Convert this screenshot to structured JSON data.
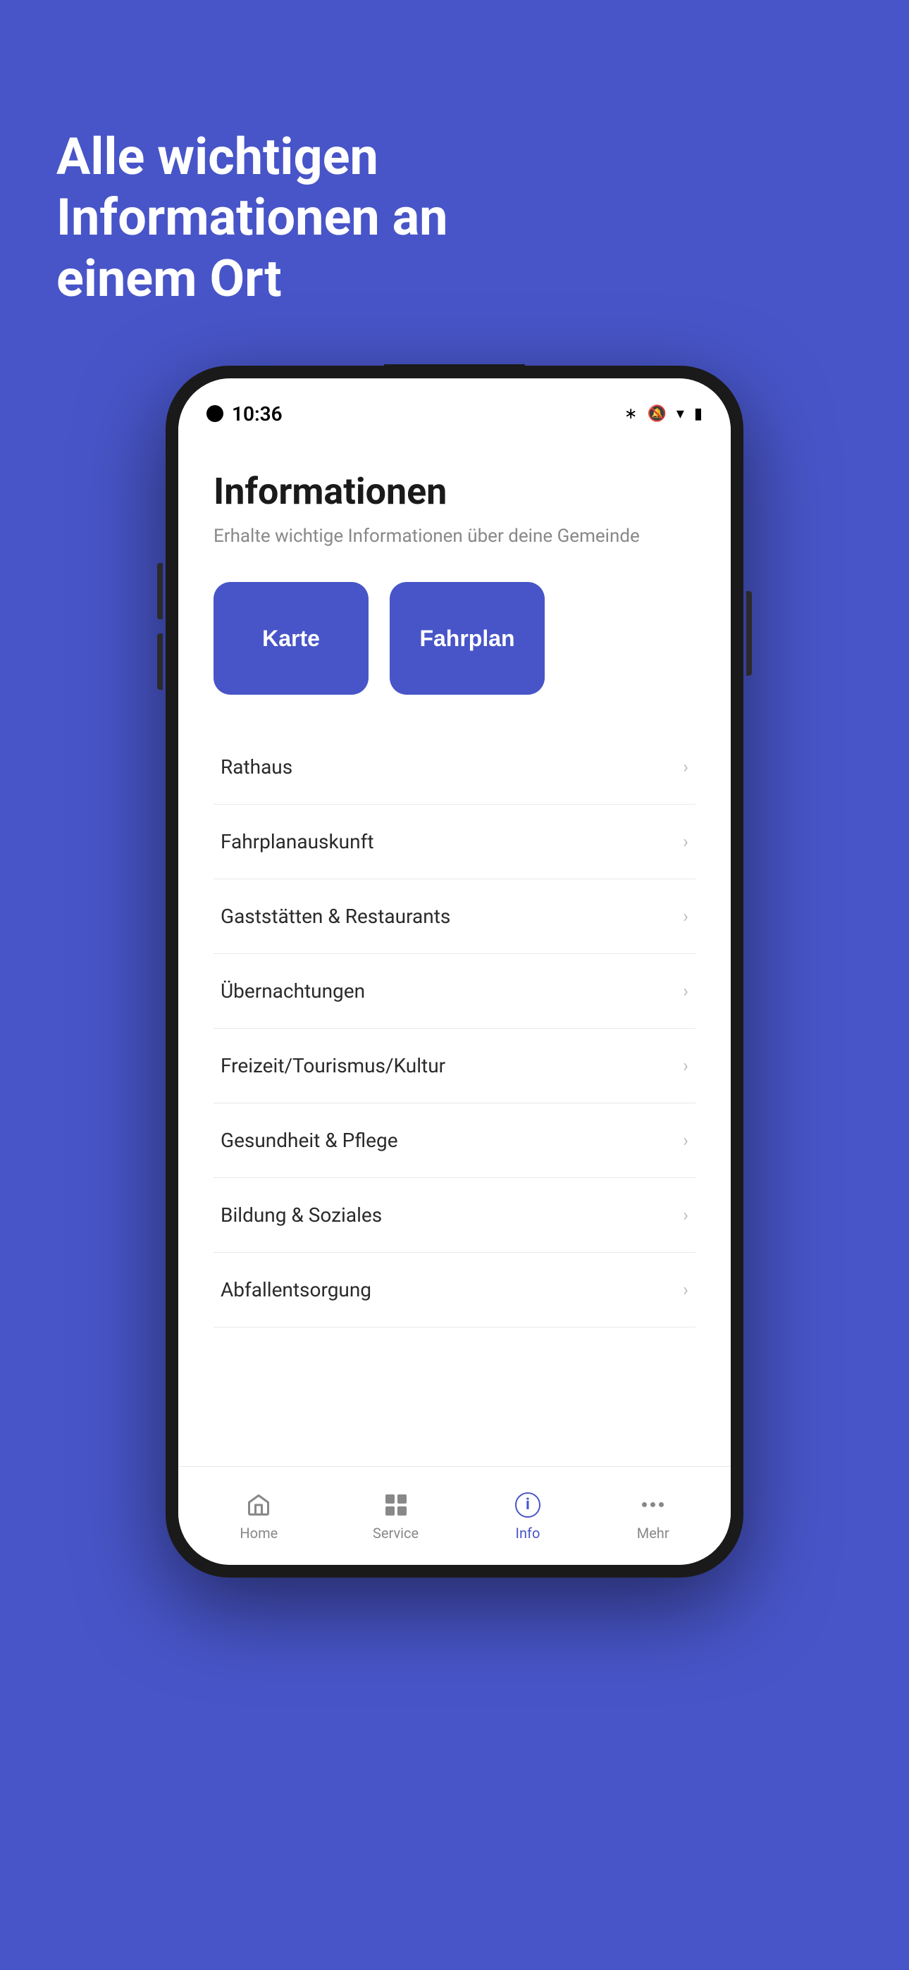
{
  "background": {
    "color": "#4855C8"
  },
  "page_title": {
    "line1": "Alle wichtigen Informationen",
    "line2": "an einem Ort",
    "full": "Alle wichtigen Informationen an einem Ort"
  },
  "status_bar": {
    "time": "10:36"
  },
  "app": {
    "title": "Informationen",
    "subtitle": "Erhalte wichtige Informationen über deine Gemeinde",
    "action_buttons": [
      {
        "label": "Karte",
        "id": "karte"
      },
      {
        "label": "Fahrplan",
        "id": "fahrplan"
      }
    ],
    "menu_items": [
      {
        "label": "Rathaus"
      },
      {
        "label": "Fahrplanauskunft"
      },
      {
        "label": "Gaststätten & Restaurants"
      },
      {
        "label": "Übernachtungen"
      },
      {
        "label": "Freizeit/Tourismus/Kultur"
      },
      {
        "label": "Gesundheit & Pflege"
      },
      {
        "label": "Bildung & Soziales"
      },
      {
        "label": "Abfallentsorgung"
      }
    ]
  },
  "bottom_nav": {
    "items": [
      {
        "label": "Home",
        "id": "home",
        "active": false
      },
      {
        "label": "Service",
        "id": "service",
        "active": false
      },
      {
        "label": "Info",
        "id": "info",
        "active": true
      },
      {
        "label": "Mehr",
        "id": "mehr",
        "active": false
      }
    ]
  }
}
